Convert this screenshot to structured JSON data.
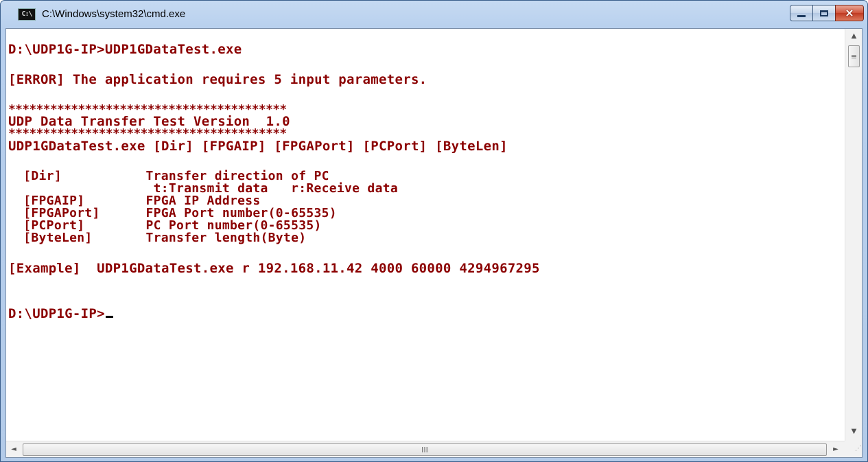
{
  "window": {
    "title": "C:\\Windows\\system32\\cmd.exe",
    "app_icon_text": "C:\\",
    "controls": {
      "minimize": "minimize",
      "maximize": "maximize",
      "close": "×"
    }
  },
  "console": {
    "text_color": "#8b0000",
    "background_color": "#ffffff",
    "lines": [
      "D:\\UDP1G-IP>UDP1GDataTest.exe",
      "[ERROR] The application requires 5 input parameters.",
      "****************************************",
      "UDP Data Transfer Test Version  1.0",
      "****************************************",
      "UDP1GDataTest.exe [Dir] [FPGAIP] [FPGAPort] [PCPort] [ByteLen]",
      "  [Dir]           Transfer direction of PC",
      "                   t:Transmit data   r:Receive data",
      "  [FPGAIP]        FPGA IP Address",
      "  [FPGAPort]      FPGA Port number(0-65535)",
      "  [PCPort]        PC Port number(0-65535)",
      "  [ByteLen]       Transfer length(Byte)",
      "[Example]  UDP1GDataTest.exe r 192.168.11.42 4000 60000 4294967295",
      "D:\\UDP1G-IP>"
    ]
  },
  "scrollbars": {
    "vertical": {
      "up": "▲",
      "down": "▼",
      "thumb_grip": "≡"
    },
    "horizontal": {
      "left": "◄",
      "right": "►",
      "thumb_grip": "III"
    },
    "size_grip": "⋰"
  }
}
